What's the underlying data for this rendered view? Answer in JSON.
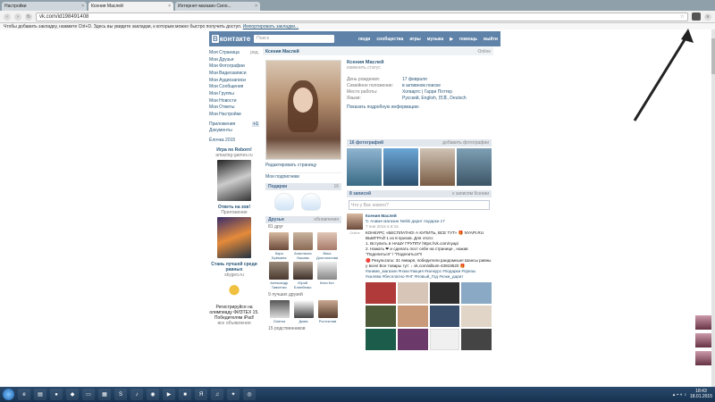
{
  "browser": {
    "tabs": [
      {
        "label": "Настройки"
      },
      {
        "label": "Ксения Маслей",
        "active": true
      },
      {
        "label": "Интернет-магазин Сило..."
      }
    ],
    "url": "vk.com/id198491408",
    "bookmarks_text": "Чтобы добавить закладку, нажмите Ctrl+D. Здесь вы увидите закладки, к которым можно быстро получить доступ.",
    "bookmarks_link": "Импортировать закладки..."
  },
  "vk": {
    "logo": "контакте",
    "logo_b": "В",
    "search_placeholder": "Поиск",
    "topnav": [
      "люди",
      "сообщества",
      "игры",
      "музыка",
      "помощь",
      "выйти"
    ],
    "menu": [
      {
        "label": "Моя Страница",
        "edit": "ред."
      },
      {
        "label": "Мои Друзья"
      },
      {
        "label": "Мои Фотографии"
      },
      {
        "label": "Мои Видеозаписи"
      },
      {
        "label": "Мои Аудиозаписи"
      },
      {
        "label": "Мои Сообщения"
      },
      {
        "label": "Мои Группы"
      },
      {
        "label": "Мои Новости"
      },
      {
        "label": "Мои Ответы"
      },
      {
        "label": "Мои Настройки"
      }
    ],
    "menu2": [
      {
        "label": "Приложения",
        "plus": "+1"
      },
      {
        "label": "Документы"
      }
    ],
    "menu3": "Ёлочка 2015",
    "ads": [
      {
        "title": "Игра по Reborn!",
        "sub": "amazing-games.ru"
      },
      {
        "title": "Ответь на зов!",
        "sub": "Приложение"
      },
      {
        "title": "Стань лучшей среди равных",
        "sub": "skygeo.ru"
      }
    ],
    "ad3_text": "Регистрируйся на олимпиаду ФИЗТЕХ 15. Победителям iPad!",
    "ad_footer": "все объявления"
  },
  "profile": {
    "namebar": "Ксения Маслей",
    "namebar_right": "Online",
    "name": "Ксения Маслей",
    "status": "изменить статус",
    "fields": [
      {
        "k": "День рождения:",
        "v": "17 февраля"
      },
      {
        "k": "Семейное положение:",
        "v": "в активном поиске"
      },
      {
        "k": "Место работы:",
        "v": "Хогвартс | Гарри Поттер"
      },
      {
        "k": "Языки:",
        "v": "Русский, English, 日本, Deutsch"
      }
    ],
    "more": "Показать подробную информацию",
    "edit_page": "Редактировать страницу",
    "subscribers": "Мои подписчики",
    "photos_head": "16 фотографий",
    "photos_right": "добавить фотографии",
    "gifts_head": "Подарки",
    "gifts_count": "16",
    "friends_head": "Друзья",
    "friends_right": "обновления",
    "friends_count": "81 друг",
    "friends": [
      {
        "name": "Кира Брёмина"
      },
      {
        "name": "Анастасия Ушкова"
      },
      {
        "name": "Вика Долгополова"
      },
      {
        "name": "Александр Тавченко"
      },
      {
        "name": "Юрий Блинбекко"
      },
      {
        "name": "Катя Кот"
      }
    ],
    "online_head": "9 лучших друзей",
    "online_friends": [
      {
        "name": "Оляпск"
      },
      {
        "name": "Дима"
      },
      {
        "name": "Ростислав"
      }
    ],
    "relatives": "15 родственников"
  },
  "wall": {
    "head": "8 записей",
    "head_right": "к записям Ксении",
    "placeholder": "Что у Вас нового?",
    "post_author": "Ксения Маслей",
    "post_repost": "Аниме магазин Nekki дарит подарки 17",
    "post_time": "7 янв 2015 в 8:16",
    "online": "Online",
    "lines": [
      "КОНКУРС «БЕСПЛАТНО! А КУПИТЬ, ВСЕ ТУТ» 🎁 NYAPI.RU",
      "ВЫИГРАЙ 1 из 8 призов. Для этого:",
      "1. Вступить в НАШУ ГРУППУ https://vk.com/nyapi",
      "2. Нажать ❤ и сделать пост себе на странице , нажав \"Поделиться\" / \"Поделиться\"‼",
      "🔴 Результаты: 31 января, победители рандомные! Шансы равны у всех! Все товары тут: ↓ vk.com/album-43919520 🎁",
      "#аниме_магазин #нэки #акция #конкурс #подарки #призы #халява #бесплатно #НГ #Новый_Год #нэки_дарит"
    ]
  },
  "taskbar": {
    "time": "18:43",
    "date": "18.01.2015"
  }
}
